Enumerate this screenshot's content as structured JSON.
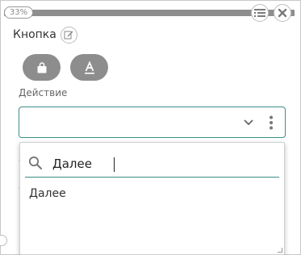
{
  "header": {
    "progress_percent": 33,
    "progress_label": "33%"
  },
  "title": "Кнопка",
  "icons": {
    "edit": "pencil-edit-icon",
    "list": "list-icon",
    "close": "close-icon",
    "bag": "bag-icon",
    "font": "underlined-a-icon",
    "chevron": "chevron-down-icon",
    "more": "more-vertical-icon",
    "search": "search-icon"
  },
  "action": {
    "label": "Действие",
    "selected": ""
  },
  "dropdown": {
    "search_value": "Далее",
    "options": [
      "Далее"
    ]
  },
  "colors": {
    "accent": "#3c8f86",
    "pill": "#8d8d8d"
  }
}
